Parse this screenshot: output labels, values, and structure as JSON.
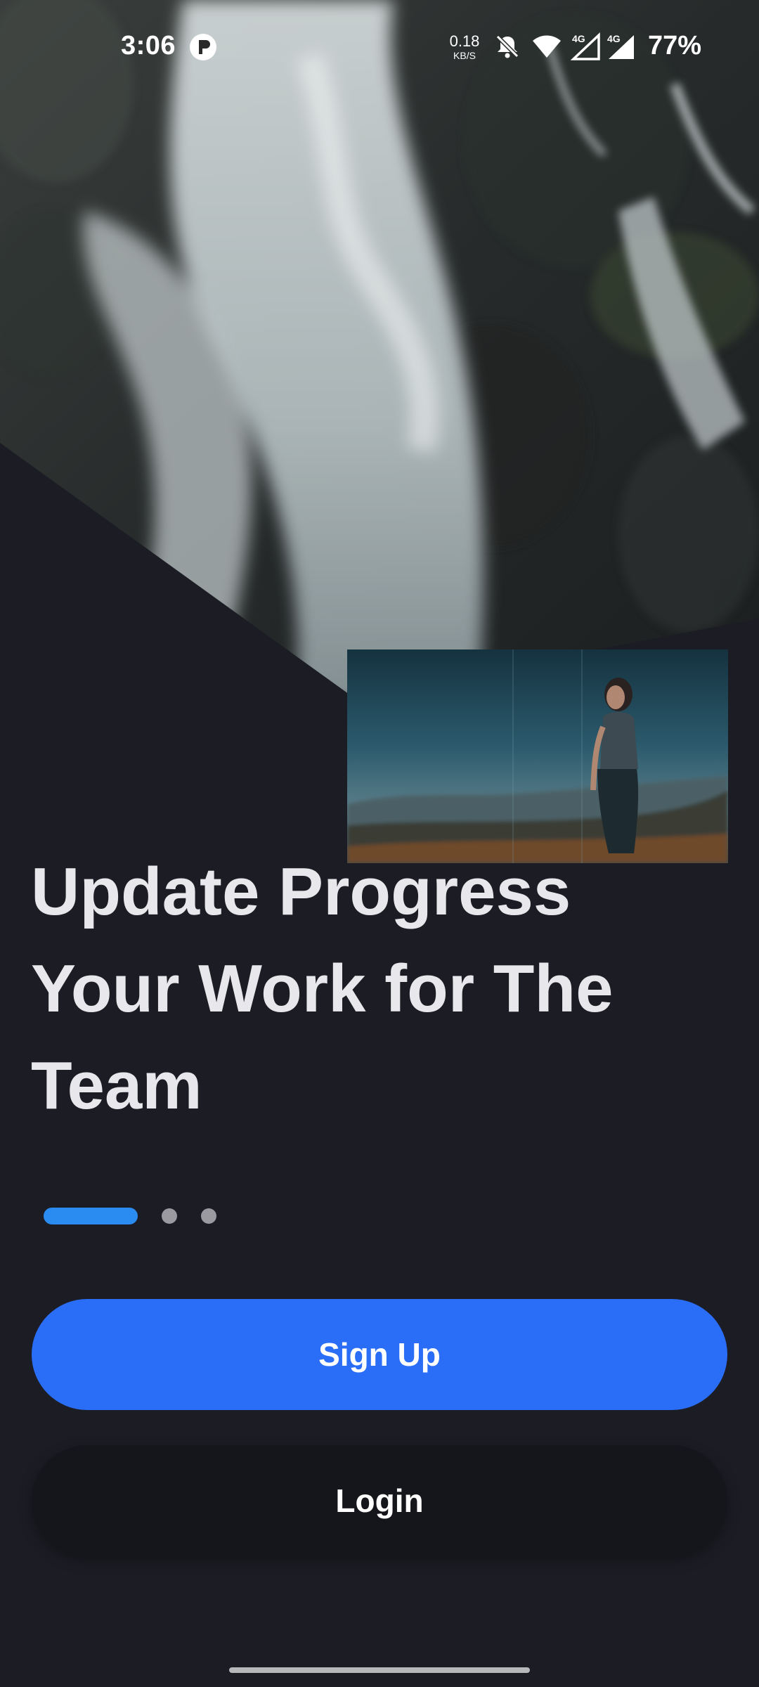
{
  "status_bar": {
    "time": "3:06",
    "network_speed_value": "0.18",
    "network_speed_unit": "KB/S",
    "signal_1_label": "4G",
    "signal_2_label": "4G",
    "battery": "77%",
    "icons": [
      "app-notification-icon",
      "bell-off-icon",
      "wifi-icon",
      "signal-icon",
      "signal-icon"
    ]
  },
  "hero": {
    "image": "waterfall-photo"
  },
  "pip_video": {
    "image": "woman-on-hilltop-video"
  },
  "onboarding": {
    "headline_lines": [
      "Update Progress",
      "Your Work for The",
      "Team"
    ],
    "pager": {
      "total": 3,
      "active_index": 0
    }
  },
  "actions": {
    "signup_label": "Sign Up",
    "login_label": "Login"
  },
  "colors": {
    "background": "#1c1c24",
    "primary": "#2a6ef8",
    "pager_active": "#2a8cf0",
    "headline": "#e8e8ec"
  }
}
